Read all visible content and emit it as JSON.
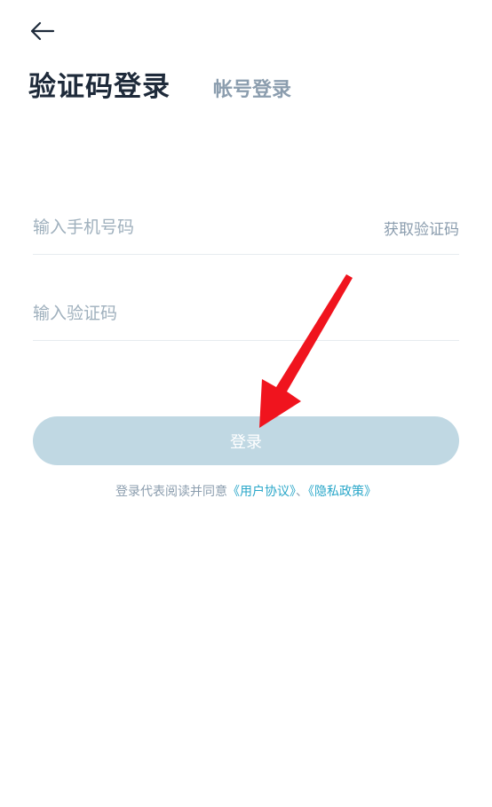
{
  "tabs": {
    "active": "验证码登录",
    "inactive": "帐号登录"
  },
  "phone": {
    "placeholder": "输入手机号码",
    "get_code": "获取验证码"
  },
  "code": {
    "placeholder": "输入验证码"
  },
  "login_label": "登录",
  "agreement": {
    "prefix": "登录代表阅读并同意",
    "user_agreement": "《用户协议》",
    "separator": "、",
    "privacy_policy": "《隐私政策》"
  },
  "colors": {
    "title": "#1e2a3a",
    "muted": "#8b9dae",
    "button": "#c0d8e3",
    "link": "#2aa7c9",
    "annotation_arrow": "#f0141e"
  }
}
